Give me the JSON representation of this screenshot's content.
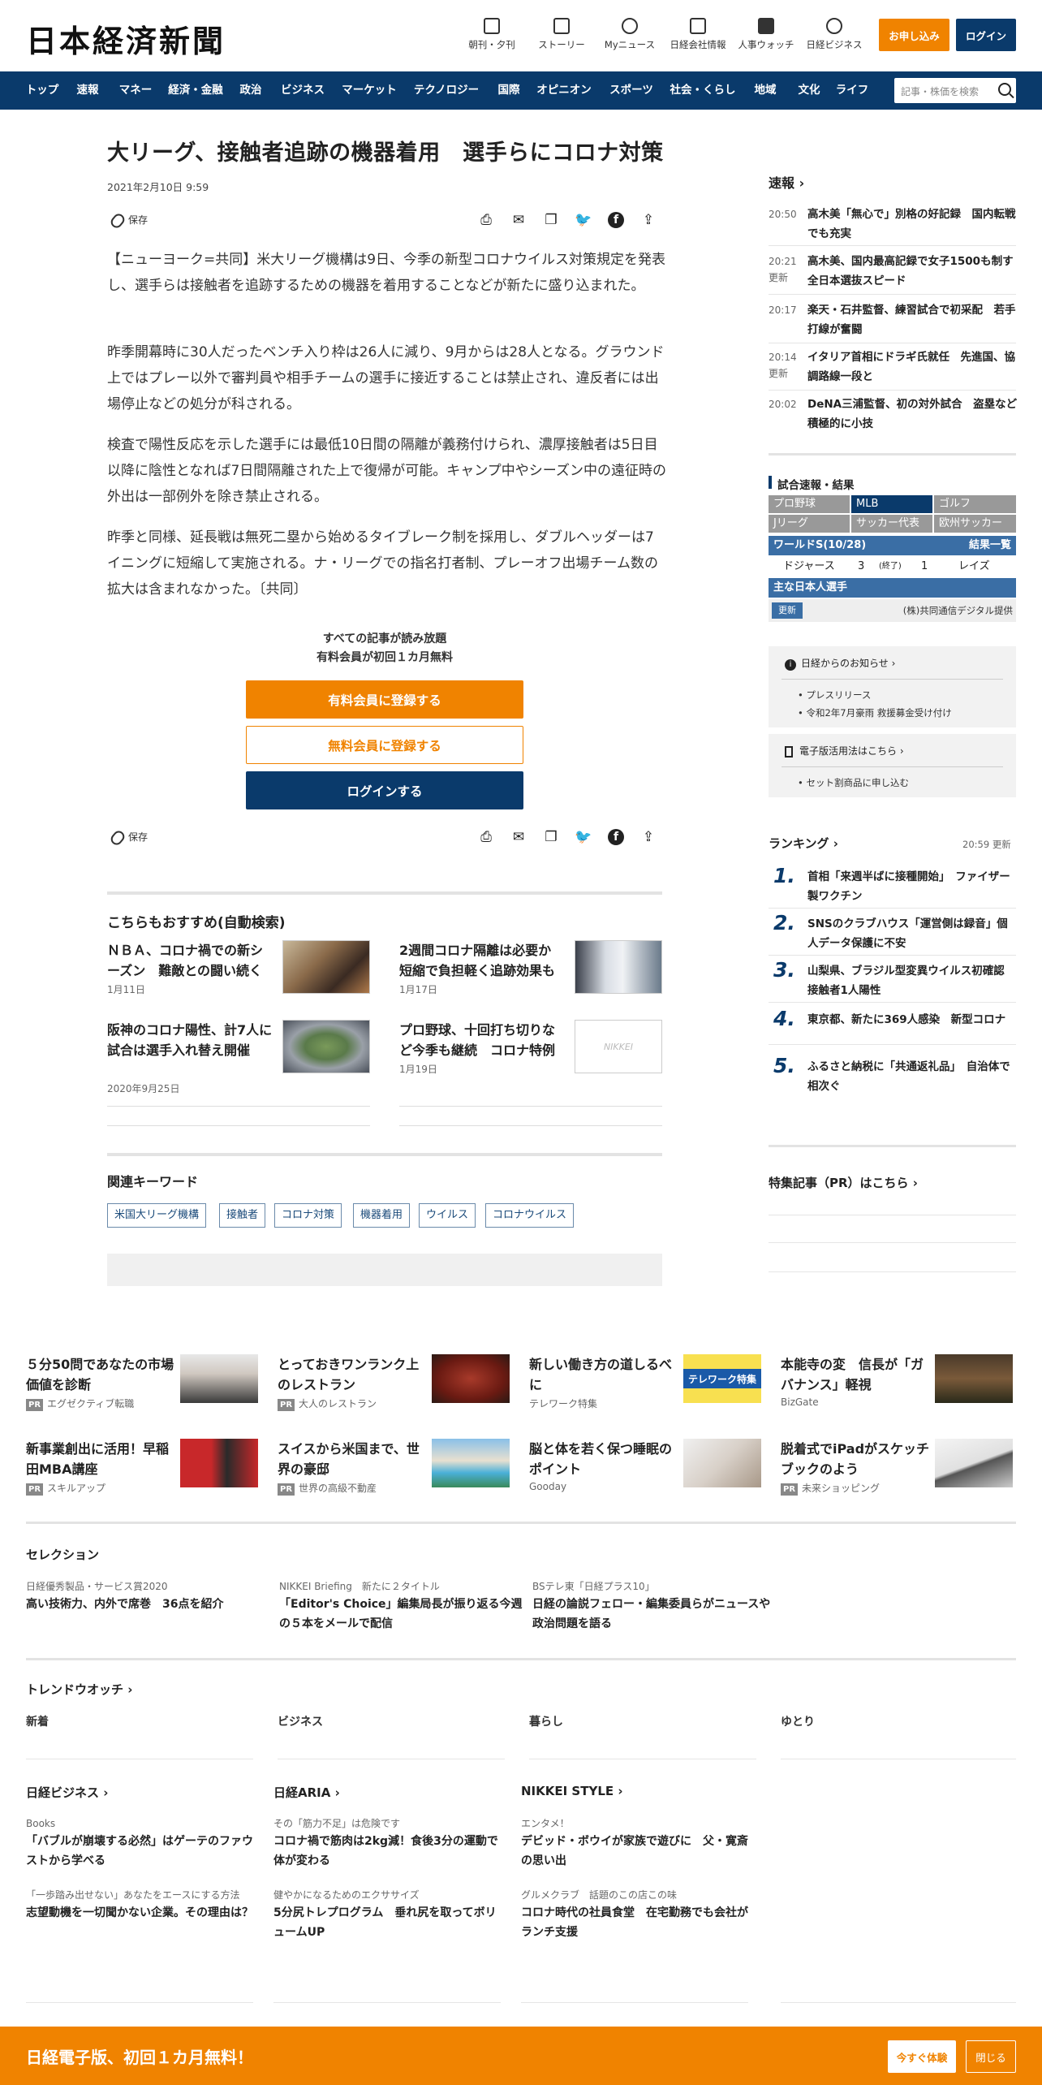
{
  "header": {
    "logo": "日本経済新聞",
    "icons": [
      {
        "label": "朝刊・夕刊",
        "icon": "newspaper-icon"
      },
      {
        "label": "ストーリー",
        "icon": "document-icon"
      },
      {
        "label": "Myニュース",
        "icon": "user-icon"
      },
      {
        "label": "日経会社情報",
        "icon": "chart-icon"
      },
      {
        "label": "人事ウォッチ",
        "icon": "search-icon"
      },
      {
        "label": "日経ビジネス",
        "icon": "compass-icon"
      }
    ],
    "subscribe_label": "お申し込み",
    "login_label": "ログイン"
  },
  "nav": {
    "items": [
      "トップ",
      "速報",
      "マネー",
      "経済・金融",
      "政治",
      "ビジネス",
      "マーケット",
      "テクノロジー",
      "国際",
      "オピニオン",
      "スポーツ",
      "社会・くらし",
      "地域",
      "文化",
      "ライフ"
    ],
    "search_placeholder": "記事・株価を検索"
  },
  "article": {
    "title": "大リーグ、接触者追跡の機器着用　選手らにコロナ対策",
    "date": "2021年2月10日 9:59",
    "save_label": "保存",
    "paragraphs": [
      "【ニューヨーク=共同】米大リーグ機構は9日、今季の新型コロナウイルス対策規定を発表し、選手らは接触者を追跡するための機器を着用することなどが新たに盛り込まれた。",
      "昨季開幕時に30人だったベンチ入り枠は26人に減り、9月からは28人となる。グラウンド上ではプレー以外で審判員や相手チームの選手に接近することは禁止され、違反者には出場停止などの処分が科される。",
      "検査で陽性反応を示した選手には最低10日間の隔離が義務付けられ、濃厚接触者は5日目以降に陰性となれば7日間隔離された上で復帰が可能。キャンプ中やシーズン中の遠征時の外出は一部例外を除き禁止される。",
      "昨季と同様、延長戦は無死二塁から始めるタイブレーク制を採用し、ダブルヘッダーは7イニングに短縮して実施される。ナ・リーグでの指名打者制、プレーオフ出場チーム数の拡大は含まれなかった。〔共同〕"
    ]
  },
  "register": {
    "line1": "すべての記事が読み放題",
    "line2": "有料会員が初回１カ月無料",
    "paid": "有料会員に登録する",
    "free": "無料会員に登録する",
    "login": "ログインする"
  },
  "recommend": {
    "title": "こちらもおすすめ(自動検索)",
    "items": [
      {
        "title": "ＮＢＡ、コロナ禍での新シーズン　難敵との闘い続く",
        "date": "1月11日"
      },
      {
        "title": "2週間コロナ隔離は必要か　短縮で負担軽く追跡効果も",
        "date": "1月17日"
      },
      {
        "title": "阪神のコロナ陽性、計7人に　試合は選手入れ替え開催",
        "date": "2020年9月25日"
      },
      {
        "title": "プロ野球、十回打ち切りなど今季も継続　コロナ特例",
        "date": "1月19日"
      }
    ],
    "placeholder_logo": "NIKKEI"
  },
  "keywords": {
    "title": "関連キーワード",
    "items": [
      "米国大リーグ機構",
      "接触者",
      "コロナ対策",
      "機器着用",
      "ウイルス",
      "コロナウイルス"
    ]
  },
  "sidebar": {
    "news_title": "速報",
    "news": [
      {
        "time": "20:50",
        "updated": "",
        "text": "高木美「無心で」別格の好記録　国内転戦でも充実"
      },
      {
        "time": "20:21",
        "updated": "更新",
        "text": "高木美、国内最高記録で女子1500も制す　全日本選抜スピード"
      },
      {
        "time": "20:17",
        "updated": "",
        "text": "楽天・石井監督、練習試合で初采配　若手打線が奮闘"
      },
      {
        "time": "20:14",
        "updated": "更新",
        "text": "イタリア首相にドラギ氏就任　先進国、協調路線一段と"
      },
      {
        "time": "20:02",
        "updated": "",
        "text": "DeNA三浦監督、初の対外試合　盗塁など積極的に小技"
      }
    ],
    "scores": {
      "title": "試合速報・結果",
      "tabs1": [
        "プロ野球",
        "MLB",
        "ゴルフ"
      ],
      "tabs2": [
        "Jリーグ",
        "サッカー代表",
        "欧州サッカー"
      ],
      "ws": "ワールドS(10/28)",
      "ws_link": "結果一覧",
      "team1": "ドジャース",
      "score1": "3",
      "status": "(終了)",
      "score2": "1",
      "team2": "レイズ",
      "japanese": "主な日本人選手",
      "update": "更新",
      "credit": "(株)共同通信デジタル提供"
    },
    "info": {
      "title": "日経からのお知らせ",
      "items": [
        "プレスリリース",
        "令和2年7月豪雨 救援募金受け付け"
      ],
      "ebook_title": "電子版活用法はこちら",
      "ebook_items": [
        "セット割商品に申し込む"
      ]
    },
    "ranking": {
      "title": "ランキング",
      "time": "20:59",
      "updated": "更新",
      "items": [
        {
          "n": "1.",
          "text": "首相「来週半ばに接種開始」　ファイザー製ワクチン"
        },
        {
          "n": "2.",
          "text": "SNSのクラブハウス「運営側は録音」個人データ保護に不安"
        },
        {
          "n": "3.",
          "text": "山梨県、ブラジル型変異ウイルス初確認　接触者1人陽性"
        },
        {
          "n": "4.",
          "text": "東京都、新たに369人感染　新型コロナ"
        },
        {
          "n": "5.",
          "text": "ふるさと納税に「共通返礼品」　自治体で相次ぐ"
        }
      ]
    },
    "pr_title": "特集記事（PR）はこちら"
  },
  "pr": {
    "items": [
      {
        "title": "５分50問であなたの市場価値を診断",
        "source": "エグゼクティブ転職",
        "pr": "PR"
      },
      {
        "title": "とっておきワンランク上のレストラン",
        "source": "大人のレストラン",
        "pr": "PR"
      },
      {
        "title": "新しい働き方の道しるべに",
        "source": "テレワーク特集",
        "pr": "",
        "img_text": "テレワーク特集"
      },
      {
        "title": "本能寺の変　信長が「ガバナンス」軽視",
        "source": "BizGate",
        "pr": ""
      },
      {
        "title": "新事業創出に活用！早稲田MBA講座",
        "source": "スキルアップ",
        "pr": "PR"
      },
      {
        "title": "スイスから米国まで、世界の豪邸",
        "source": "世界の高級不動産",
        "pr": "PR"
      },
      {
        "title": "脳と体を若く保つ睡眠のポイント",
        "source": "Gooday",
        "pr": ""
      },
      {
        "title": "脱着式でiPadがスケッチブックのよう",
        "source": "未来ショッピング",
        "pr": "PR"
      }
    ]
  },
  "selection": {
    "title": "セレクション",
    "items": [
      {
        "sub": "日経優秀製品・サービス賞2020",
        "title": "高い技術力、内外で席巻　36点を紹介"
      },
      {
        "sub": "NIKKEI Briefing　新たに２タイトル",
        "title": "「Editor's Choice」編集局長が振り返る今週の５本をメールで配信"
      },
      {
        "sub": "BSテレ東「日経プラス10」",
        "title": "日経の論説フェロー・編集委員らがニュースや政治問題を語る"
      }
    ]
  },
  "trend": {
    "title": "トレンドウオッチ",
    "tabs": [
      "新着",
      "ビジネス",
      "暮らし",
      "ゆとり"
    ]
  },
  "brands": [
    {
      "title": "日経ビジネス",
      "items": [
        {
          "sub": "Books",
          "title": "「バブルが崩壊する必然」はゲーテのファウストから学べる"
        },
        {
          "sub": "「一歩踏み出せない」あなたをエースにする方法",
          "title": "志望動機を一切聞かない企業。その理由は？"
        }
      ]
    },
    {
      "title": "日経ARIA",
      "items": [
        {
          "sub": "その「筋力不足」は危険です",
          "title": "コロナ禍で筋肉は2kg減！食後3分の運動で体が変わる"
        },
        {
          "sub": "健やかになるためのエクササイズ",
          "title": "5分尻トレプログラム　垂れ尻を取ってボリュームUP"
        }
      ]
    },
    {
      "title": "NIKKEI STYLE",
      "items": [
        {
          "sub": "エンタメ！",
          "title": "デビッド・ボウイが家族で遊びに　父・寛斎の思い出"
        },
        {
          "sub": "グルメクラブ　話題のこの店この味",
          "title": "コロナ時代の社員食堂　在宅勤務でも会社がランチ支援"
        }
      ]
    }
  ],
  "footer": {
    "text": "日経電子版、初回１カ月無料！",
    "trial": "今すぐ体験",
    "close": "閉じる"
  }
}
